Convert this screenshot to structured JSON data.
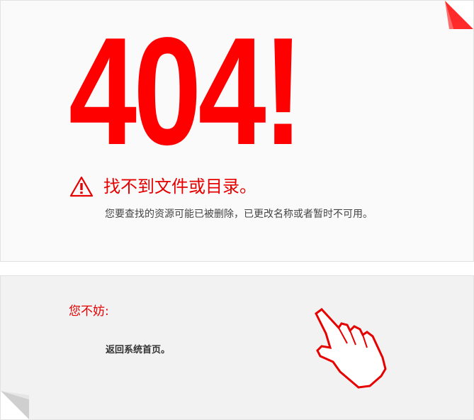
{
  "error": {
    "code_text": "404!",
    "headline": "找不到文件或目录。",
    "message": "您要查找的资源可能已被删除，已更改名称或者暂时不可用。",
    "warning_icon": "warning-triangle-icon"
  },
  "suggestions": {
    "label": "您不妨:",
    "home_link": "返回系统首页。",
    "pointer_icon": "pointing-hand-icon"
  },
  "colors": {
    "accent": "#ff0000",
    "panel_top": "#fafafa",
    "panel_bottom": "#f2f2f2",
    "text": "#444444"
  }
}
